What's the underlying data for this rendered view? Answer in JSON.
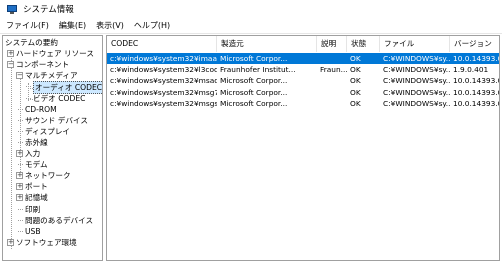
{
  "window": {
    "title": "システム情報"
  },
  "menu": {
    "items": [
      "ファイル(F)",
      "編集(E)",
      "表示(V)",
      "ヘルプ(H)"
    ]
  },
  "tree": {
    "items": [
      {
        "label": "システムの要約",
        "expander": ""
      },
      {
        "label": "ハードウェア リソース",
        "expander": "+"
      },
      {
        "label": "コンポーネント",
        "expander": "−"
      },
      {
        "label": "マルチメディア",
        "expander": "−"
      },
      {
        "label": "オーディオ CODEC",
        "expander": ""
      },
      {
        "label": "ビデオ CODEC",
        "expander": ""
      },
      {
        "label": "CD-ROM",
        "expander": ""
      },
      {
        "label": "サウンド デバイス",
        "expander": ""
      },
      {
        "label": "ディスプレイ",
        "expander": ""
      },
      {
        "label": "赤外線",
        "expander": ""
      },
      {
        "label": "入力",
        "expander": "+"
      },
      {
        "label": "モデム",
        "expander": ""
      },
      {
        "label": "ネットワーク",
        "expander": "+"
      },
      {
        "label": "ポート",
        "expander": "+"
      },
      {
        "label": "記憶域",
        "expander": "+"
      },
      {
        "label": "印刷",
        "expander": ""
      },
      {
        "label": "問題のあるデバイス",
        "expander": ""
      },
      {
        "label": "USB",
        "expander": ""
      },
      {
        "label": "ソフトウェア環境",
        "expander": "+"
      }
    ]
  },
  "list": {
    "columns": [
      "CODEC",
      "製造元",
      "説明",
      "状態",
      "ファイル",
      "バージョン"
    ],
    "rows": [
      [
        "c:¥windows¥system32¥imaadp32.acm",
        "Microsoft Corpor...",
        "",
        "OK",
        "C:¥WINDOWS¥sy...",
        "10.0.14393.0"
      ],
      [
        "c:¥windows¥system32¥l3codeca.acm",
        "Fraunhofer Institut...",
        "Fraun...",
        "OK",
        "C:¥WINDOWS¥sy...",
        "1.9.0.401"
      ],
      [
        "c:¥windows¥system32¥msadp32.acm",
        "Microsoft Corpor...",
        "",
        "OK",
        "C:¥WINDOWS¥sy...",
        "10.0.14393.0"
      ],
      [
        "c:¥windows¥system32¥msg711.acm",
        "Microsoft Corpor...",
        "",
        "OK",
        "C:¥WINDOWS¥sy...",
        "10.0.14393.0"
      ],
      [
        "c:¥windows¥system32¥msgsm32.acm",
        "Microsoft Corpor...",
        "",
        "OK",
        "C:¥WINDOWS¥sy...",
        "10.0.14393.0"
      ]
    ]
  },
  "colors": {
    "selection": "#0078d7",
    "tree_selection": "#cde8ff",
    "border": "#a0a0a0"
  }
}
